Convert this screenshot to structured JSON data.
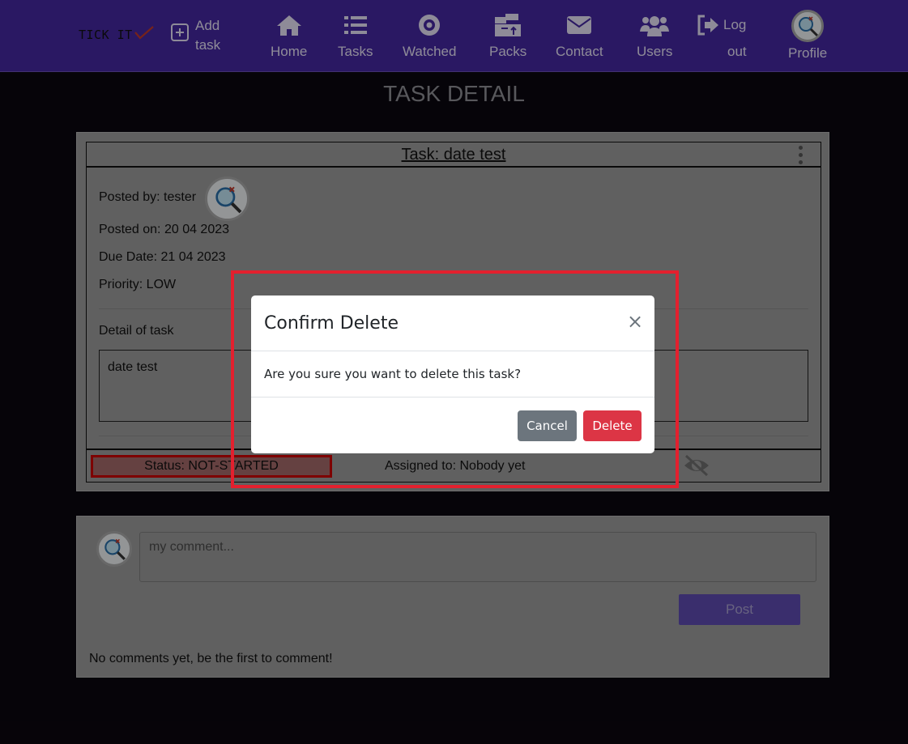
{
  "navbar": {
    "brand": "TICK IT",
    "add_task_line1": "Add",
    "add_task_line2": "task",
    "items": [
      {
        "label": "Home",
        "icon": "home-icon"
      },
      {
        "label": "Tasks",
        "icon": "list-icon"
      },
      {
        "label": "Watched",
        "icon": "eye-icon"
      },
      {
        "label": "Packs",
        "icon": "archive-icon"
      },
      {
        "label": "Contact",
        "icon": "envelope-icon"
      },
      {
        "label": "Users",
        "icon": "users-icon"
      },
      {
        "label": "Profile",
        "icon": "avatar"
      }
    ],
    "logout_line1": "Log",
    "logout_line2": "out"
  },
  "page": {
    "title": "TASK DETAIL"
  },
  "task": {
    "header": "Task: date test",
    "posted_by": "Posted by: tester",
    "posted_on": "Posted on: 20 04 2023",
    "due_date": "Due Date: 21 04 2023",
    "priority": "Priority: LOW",
    "detail_label": "Detail of task",
    "detail_text": "date test",
    "status": "Status: NOT-STARTED",
    "assigned": "Assigned to: Nobody yet"
  },
  "comments": {
    "placeholder": "my comment...",
    "post_label": "Post",
    "empty_text": "No comments yet, be the first to comment!"
  },
  "modal": {
    "title": "Confirm Delete",
    "close_glyph": "×",
    "body": "Are you sure you want to delete this task?",
    "cancel_label": "Cancel",
    "delete_label": "Delete"
  },
  "colors": {
    "navbar": "#4527a0",
    "background": "#0b070f",
    "highlight": "#e3202e",
    "delete": "#dc3545",
    "cancel": "#6c757d",
    "post": "#5e4bb0"
  }
}
